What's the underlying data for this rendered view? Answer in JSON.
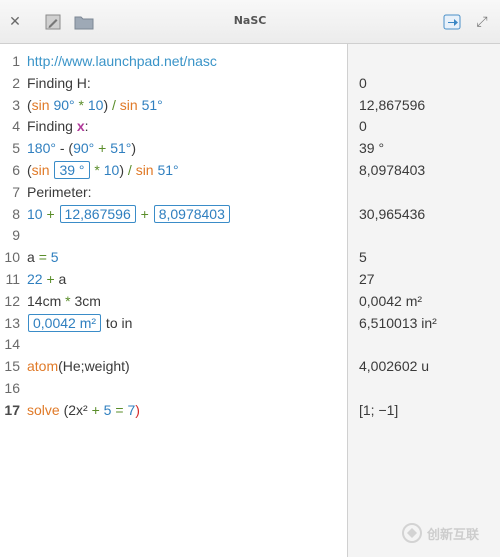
{
  "window": {
    "title": "NaSC"
  },
  "lines": [
    {
      "n": "1",
      "parts": [
        {
          "t": "http://www.launchpad.net/nasc",
          "c": "link"
        }
      ]
    },
    {
      "n": "2",
      "parts": [
        {
          "t": "Finding H:",
          "c": ""
        }
      ]
    },
    {
      "n": "3",
      "parts": [
        {
          "t": "(",
          "c": ""
        },
        {
          "t": "sin",
          "c": "kw"
        },
        {
          "t": " ",
          "c": ""
        },
        {
          "t": "90°",
          "c": "num"
        },
        {
          "t": " ",
          "c": ""
        },
        {
          "t": "*",
          "c": "op"
        },
        {
          "t": " ",
          "c": ""
        },
        {
          "t": "10",
          "c": "num"
        },
        {
          "t": ") ",
          "c": ""
        },
        {
          "t": "/",
          "c": "op"
        },
        {
          "t": " ",
          "c": ""
        },
        {
          "t": "sin",
          "c": "kw"
        },
        {
          "t": " ",
          "c": ""
        },
        {
          "t": "51°",
          "c": "num"
        }
      ]
    },
    {
      "n": "4",
      "parts": [
        {
          "t": "Finding ",
          "c": ""
        },
        {
          "t": "x",
          "c": "var"
        },
        {
          "t": ":",
          "c": ""
        }
      ]
    },
    {
      "n": "5",
      "parts": [
        {
          "t": "180°",
          "c": "num"
        },
        {
          "t": " - (",
          "c": ""
        },
        {
          "t": "90°",
          "c": "num"
        },
        {
          "t": " ",
          "c": ""
        },
        {
          "t": "+",
          "c": "op"
        },
        {
          "t": " ",
          "c": ""
        },
        {
          "t": "51°",
          "c": "num"
        },
        {
          "t": ")",
          "c": ""
        }
      ]
    },
    {
      "n": "6",
      "parts": [
        {
          "t": "(",
          "c": ""
        },
        {
          "t": "sin",
          "c": "kw"
        },
        {
          "t": " ",
          "c": ""
        },
        {
          "t": "39 °",
          "c": "box"
        },
        {
          "t": " ",
          "c": ""
        },
        {
          "t": "*",
          "c": "op"
        },
        {
          "t": " ",
          "c": ""
        },
        {
          "t": "10",
          "c": "num"
        },
        {
          "t": ") ",
          "c": ""
        },
        {
          "t": "/",
          "c": "op"
        },
        {
          "t": " ",
          "c": ""
        },
        {
          "t": "sin",
          "c": "kw"
        },
        {
          "t": " ",
          "c": ""
        },
        {
          "t": "51°",
          "c": "num"
        }
      ]
    },
    {
      "n": "7",
      "parts": [
        {
          "t": "Perimeter:",
          "c": ""
        }
      ]
    },
    {
      "n": "8",
      "parts": [
        {
          "t": "10",
          "c": "num"
        },
        {
          "t": " ",
          "c": ""
        },
        {
          "t": "+",
          "c": "op"
        },
        {
          "t": " ",
          "c": ""
        },
        {
          "t": "12,867596",
          "c": "box"
        },
        {
          "t": " ",
          "c": ""
        },
        {
          "t": "+",
          "c": "op"
        },
        {
          "t": " ",
          "c": ""
        },
        {
          "t": "8,0978403",
          "c": "box"
        }
      ]
    },
    {
      "n": "9",
      "parts": []
    },
    {
      "n": "10",
      "parts": [
        {
          "t": "a",
          "c": ""
        },
        {
          "t": " ",
          "c": ""
        },
        {
          "t": "=",
          "c": "op"
        },
        {
          "t": " ",
          "c": ""
        },
        {
          "t": "5",
          "c": "num"
        }
      ]
    },
    {
      "n": "11",
      "parts": [
        {
          "t": "22",
          "c": "num"
        },
        {
          "t": " ",
          "c": ""
        },
        {
          "t": "+",
          "c": "op"
        },
        {
          "t": " a",
          "c": ""
        }
      ]
    },
    {
      "n": "12",
      "parts": [
        {
          "t": "14cm",
          "c": ""
        },
        {
          "t": " ",
          "c": ""
        },
        {
          "t": "*",
          "c": "op"
        },
        {
          "t": " 3cm",
          "c": ""
        }
      ]
    },
    {
      "n": "13",
      "parts": [
        {
          "t": "0,0042 m²",
          "c": "box"
        },
        {
          "t": " to in",
          "c": ""
        }
      ]
    },
    {
      "n": "14",
      "parts": []
    },
    {
      "n": "15",
      "parts": [
        {
          "t": "atom",
          "c": "kw"
        },
        {
          "t": "(He;weight)",
          "c": ""
        }
      ]
    },
    {
      "n": "16",
      "parts": []
    },
    {
      "n": "17",
      "parts": [
        {
          "t": "solve",
          "c": "kw"
        },
        {
          "t": " (",
          "c": ""
        },
        {
          "t": "2x²",
          "c": ""
        },
        {
          "t": " ",
          "c": ""
        },
        {
          "t": "+",
          "c": "op"
        },
        {
          "t": " ",
          "c": ""
        },
        {
          "t": "5",
          "c": "num"
        },
        {
          "t": " ",
          "c": ""
        },
        {
          "t": "=",
          "c": "op"
        },
        {
          "t": " ",
          "c": ""
        },
        {
          "t": "7",
          "c": "num"
        },
        {
          "t": ")",
          "c": "red"
        }
      ]
    }
  ],
  "active_line": "17",
  "results": [
    "",
    "0",
    "12,867596",
    "0",
    "39 °",
    "8,0978403",
    "",
    "30,965436",
    "",
    "5",
    "27",
    "0,0042 m²",
    "6,510013 in²",
    "",
    "4,002602 u",
    "",
    "[1; −1]"
  ],
  "watermark": {
    "text": "创新互联"
  },
  "icons": [
    "close-icon",
    "edit-icon",
    "folder-icon",
    "export-icon",
    "maximize-icon"
  ],
  "colors": {
    "keyword": "#e07a28",
    "number": "#2f7fbf",
    "operator": "#5a8d2a",
    "variable": "#b03a9a",
    "link": "#3a94c8",
    "results_bg": "#f4f4f4"
  }
}
